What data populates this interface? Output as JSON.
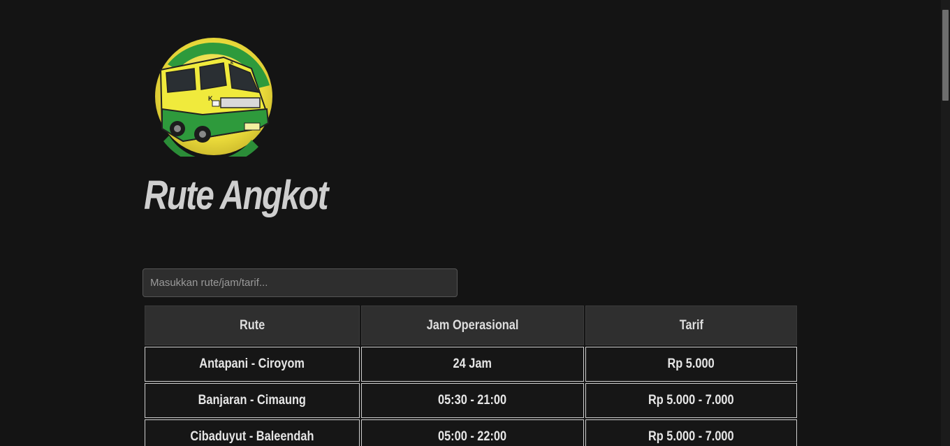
{
  "header": {
    "logo_icon": "angkot-van-logo",
    "title": "Rute Angkot"
  },
  "search": {
    "placeholder": "Masukkan rute/jam/tarif..."
  },
  "table": {
    "headers": [
      "Rute",
      "Jam Operasional",
      "Tarif"
    ],
    "rows": [
      [
        "Antapani - Ciroyom",
        "24 Jam",
        "Rp 5.000"
      ],
      [
        "Banjaran - Cimaung",
        "05:30 - 21:00",
        "Rp 5.000 - 7.000"
      ],
      [
        "Cibaduyut - Baleendah",
        "05:00 - 22:00",
        "Rp 5.000 - 7.000"
      ]
    ]
  },
  "colors": {
    "background": "#141414",
    "angkot_green": "#2e9a3c",
    "angkot_yellow": "#e6e23a"
  }
}
